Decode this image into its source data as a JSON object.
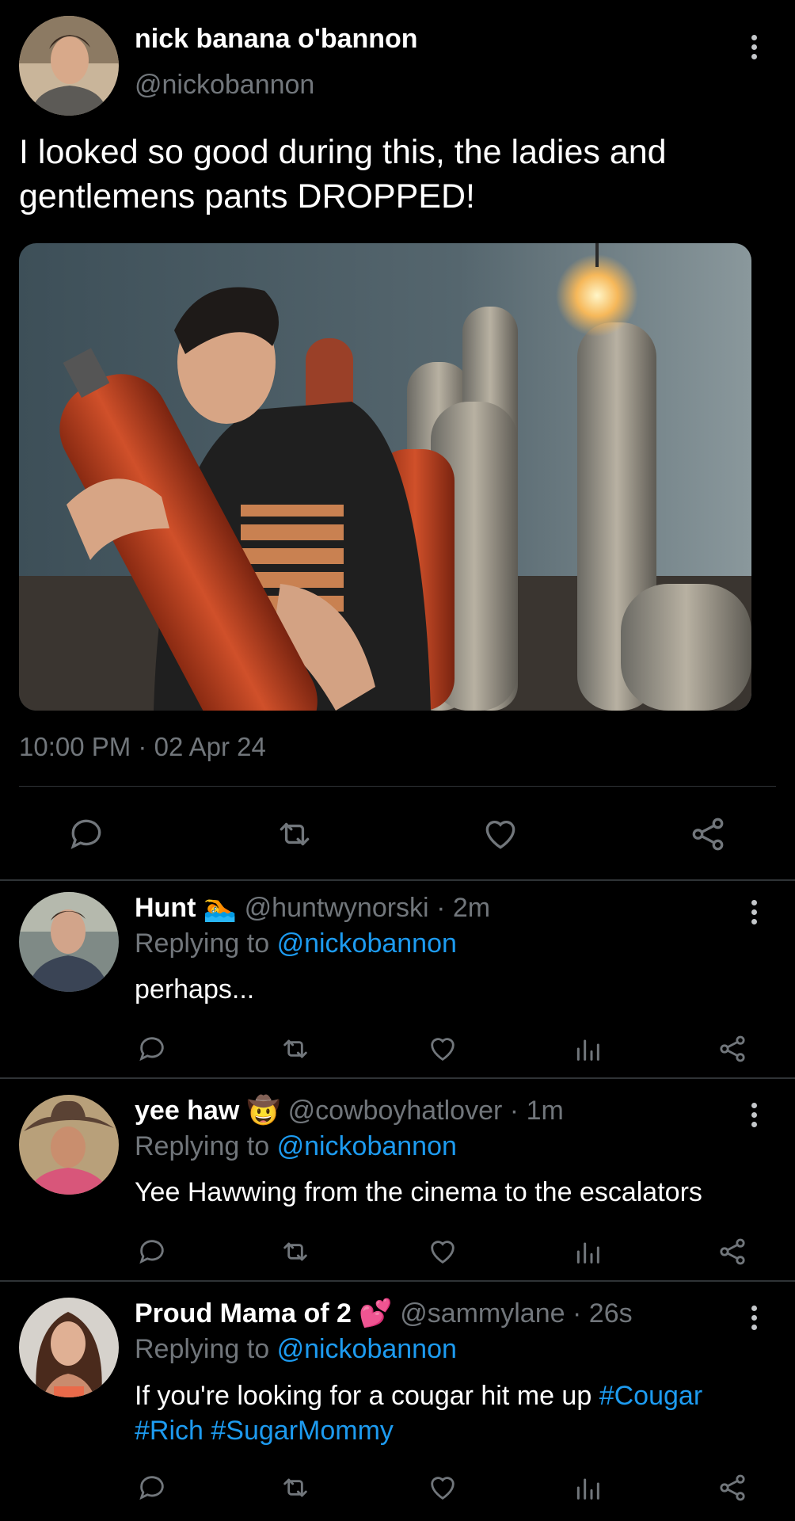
{
  "tweet": {
    "author_name": "nick banana o'bannon",
    "author_handle": "@nickobannon",
    "text_line1": "I looked so good during this, the ladies and",
    "text_line2": "gentlemens pants DROPPED!",
    "time": "10:00 PM",
    "date": "02 Apr 24",
    "separator": "·"
  },
  "replies": [
    {
      "name": "Hunt",
      "emoji": "🏊",
      "handle": "@huntwynorski",
      "time": "2m",
      "replying_prefix": "Replying to",
      "replying_handle": "@nickobannon",
      "text": "perhaps..."
    },
    {
      "name": "yee haw",
      "emoji": "🤠",
      "handle": "@cowboyhatlover",
      "time": "1m",
      "replying_prefix": "Replying to",
      "replying_handle": "@nickobannon",
      "text": "Yee Hawwing from the cinema to the escalators"
    },
    {
      "name": "Proud Mama of 2",
      "emoji": "💕",
      "handle": "@sammylane",
      "time": "26s",
      "replying_prefix": "Replying to",
      "replying_handle": "@nickobannon",
      "text_start": "If you're looking for a cougar hit me up",
      "tag1": "#Cougar",
      "tag2": "#Rich",
      "tag3": "#SugarMommy"
    }
  ],
  "icons": [
    "more-vertical-icon",
    "reply-icon",
    "retweet-icon",
    "like-icon",
    "share-icon",
    "analytics-icon"
  ],
  "colors": {
    "background": "#000000",
    "link": "#1d9bf0",
    "muted": "#71767b",
    "divider": "#2f3336"
  }
}
